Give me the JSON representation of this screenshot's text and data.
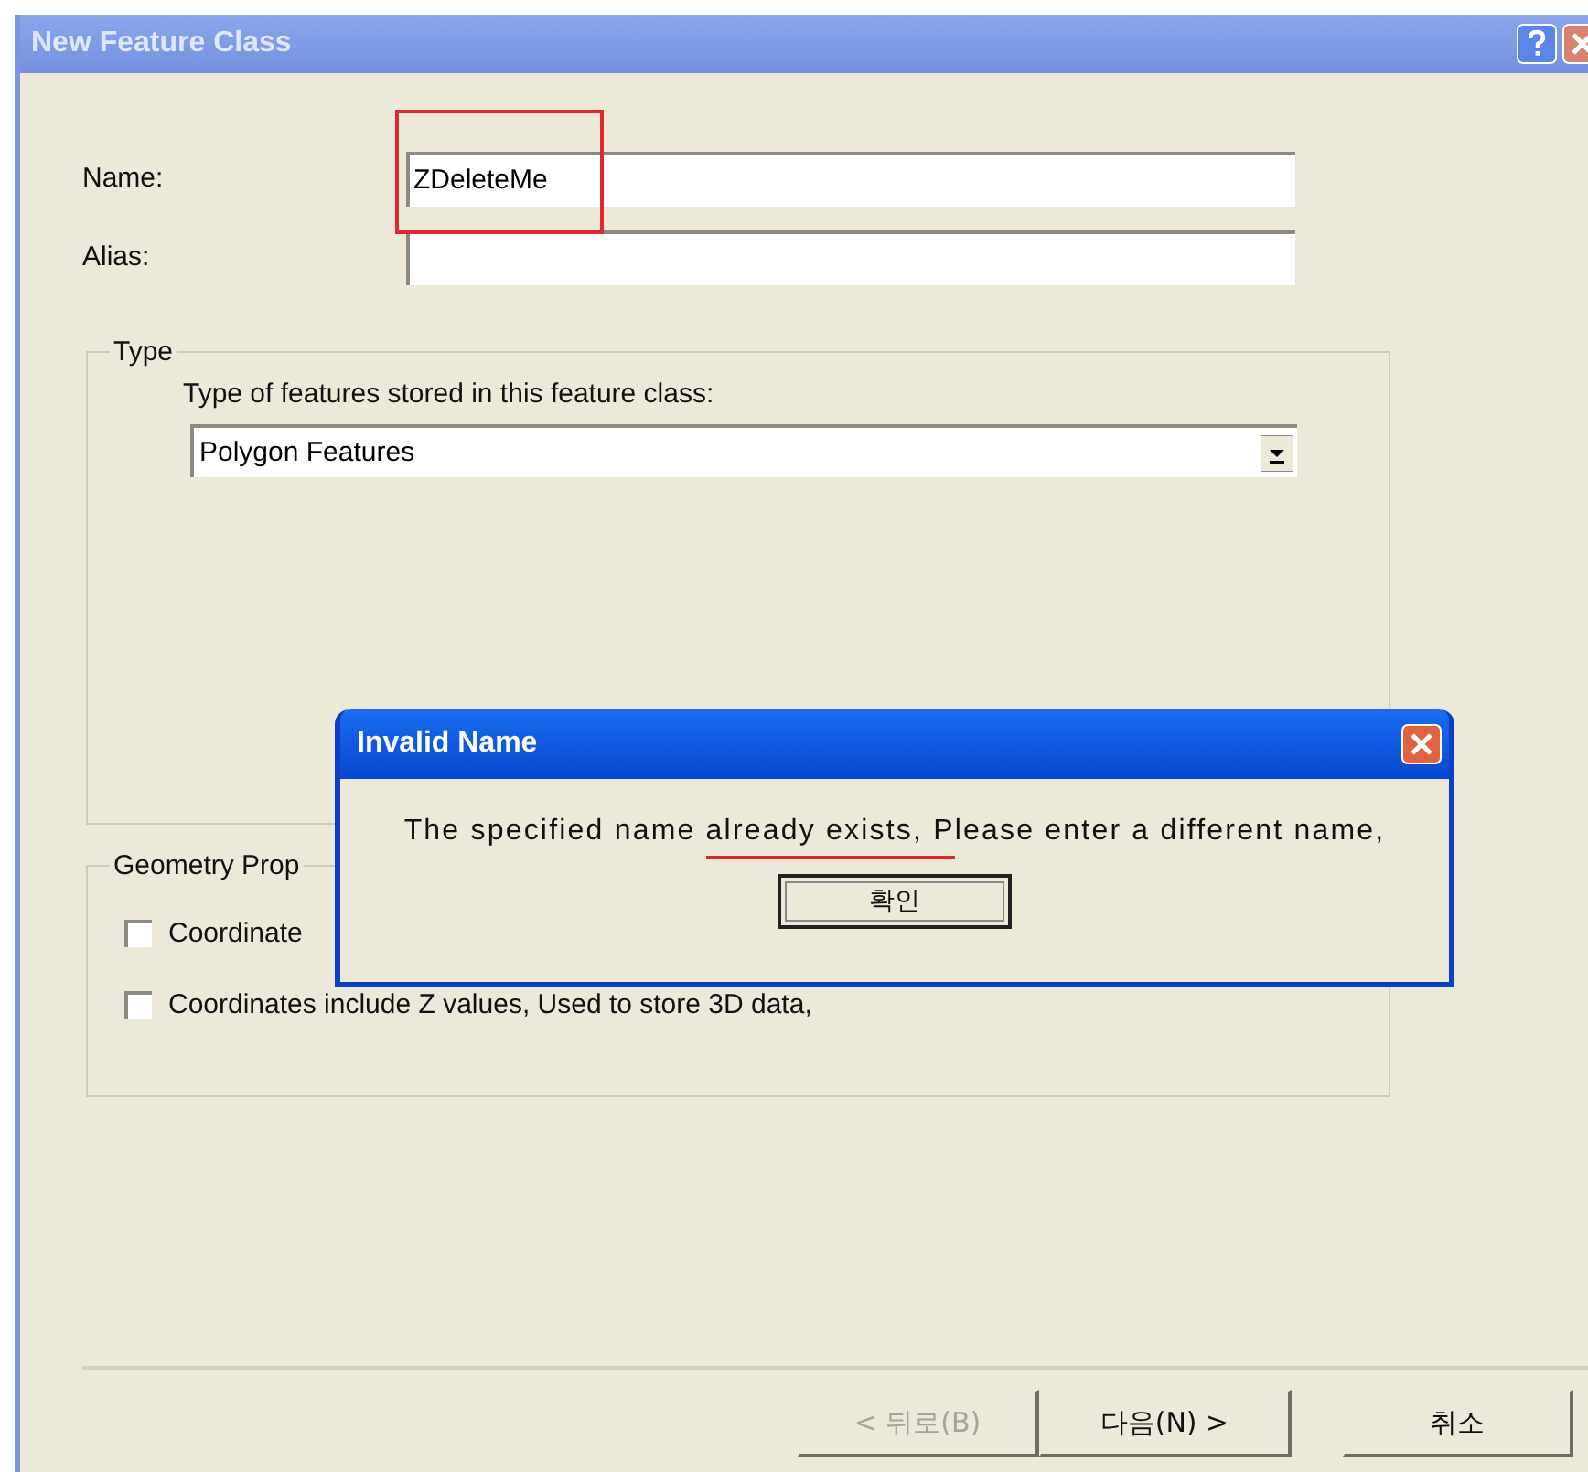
{
  "window": {
    "title": "New Feature Class",
    "active": false
  },
  "name_field": {
    "label": "Name:",
    "value": "ZDeleteMe"
  },
  "alias_field": {
    "label": "Alias:"
  },
  "type_group": {
    "title": "Type",
    "prompt": "Type of features stored in this feature class:",
    "dropdown": {
      "value": "Polygon Features"
    }
  },
  "geometry_group": {
    "title": "Geometry Prop",
    "options": [
      {
        "label": "Coordinate",
        "checked": false
      },
      {
        "label": "Coordinates include Z values, Used to store 3D data,",
        "checked": false
      }
    ]
  },
  "buttons": [
    {
      "label": "< 뒤로(B)",
      "disabled": true
    },
    {
      "label": "다음(N) >",
      "disabled": false
    },
    {
      "label": "취소",
      "disabled": false
    }
  ],
  "message_box": {
    "title": "Invalid Name",
    "message": "The specified name already exists, Please enter a different name,",
    "button": "확인"
  }
}
